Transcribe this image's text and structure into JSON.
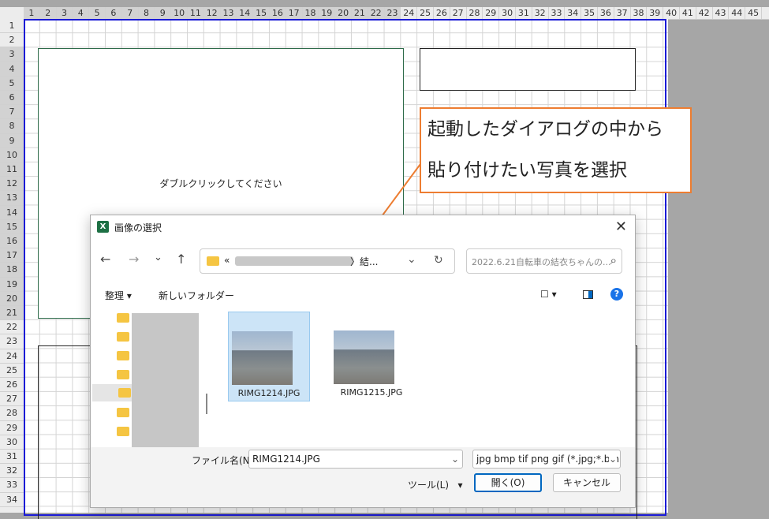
{
  "columns": [
    "1",
    "2",
    "3",
    "4",
    "5",
    "6",
    "7",
    "8",
    "9",
    "10",
    "11",
    "12",
    "13",
    "14",
    "15",
    "16",
    "17",
    "18",
    "19",
    "20",
    "21",
    "22",
    "23",
    "24",
    "25",
    "26",
    "27",
    "28",
    "29",
    "30",
    "31",
    "32",
    "33",
    "34",
    "35",
    "36",
    "37",
    "38",
    "39",
    "40",
    "41",
    "42",
    "43",
    "44",
    "45"
  ],
  "rows": [
    "1",
    "2",
    "3",
    "4",
    "5",
    "6",
    "7",
    "8",
    "9",
    "10",
    "11",
    "12",
    "13",
    "14",
    "15",
    "16",
    "17",
    "18",
    "19",
    "20",
    "21",
    "22",
    "23",
    "24",
    "25",
    "26",
    "27",
    "28",
    "29",
    "30",
    "31",
    "32",
    "33",
    "34"
  ],
  "sheet": {
    "photo_hint": "ダブルクリックしてください"
  },
  "callout": {
    "line1": "起動したダイアログの中から",
    "line2": "貼り付けたい写真を選択"
  },
  "dialog": {
    "app_icon_letter": "X",
    "title": "画像の選択",
    "close": "✕",
    "nav": {
      "back": "←",
      "forward": "→",
      "recent": "⌄",
      "up": "↑"
    },
    "address_prefix": "«",
    "address_suffix": "〉結...",
    "refresh": "↻",
    "search_placeholder": "2022.6.21自転車の結衣ちゃんの...",
    "search_icon": "⌕",
    "toolbar": {
      "organize": "整理",
      "new_folder": "新しいフォルダー",
      "help": "?"
    },
    "files": [
      {
        "name": "RIMG1214.JPG",
        "selected": true
      },
      {
        "name": "RIMG1215.JPG",
        "selected": false
      }
    ],
    "filename_label": "ファイル名(N):",
    "filename_value": "RIMG1214.JPG",
    "filetype_value": "jpg bmp tif png gif (*.jpg;*.bmp",
    "tools_label": "ツール(L)",
    "open_label": "開く(O)",
    "cancel_label": "キャンセル"
  },
  "colors": {
    "sheet_border": "#1b1bd6",
    "photo_box_border": "#2e6b4a",
    "callout_border": "#ed7d31",
    "excel_green": "#1d7044",
    "selection": "#cce4f7",
    "primary_button": "#0067c0"
  }
}
